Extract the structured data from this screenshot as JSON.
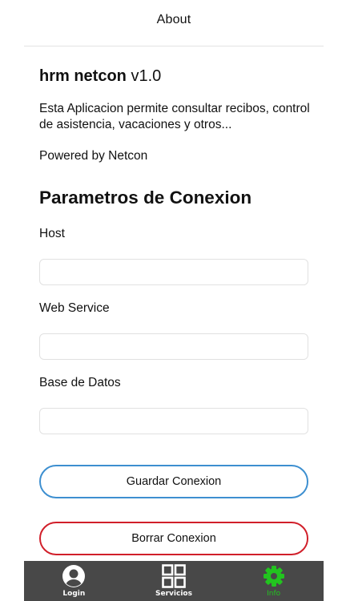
{
  "header": {
    "title": "About"
  },
  "about": {
    "app_name": "hrm netcon",
    "version": "v1.0",
    "description": "Esta Aplicacion permite consultar recibos, control de asistencia, vacaciones y otros...",
    "powered_by": "Powered by Netcon"
  },
  "connection": {
    "section_title": "Parametros de Conexion",
    "host_label": "Host",
    "host_value": "",
    "webservice_label": "Web Service",
    "webservice_value": "",
    "database_label": "Base de Datos",
    "database_value": ""
  },
  "buttons": {
    "save_label": "Guardar Conexion",
    "delete_label": "Borrar Conexion"
  },
  "tabs": [
    {
      "label": "Login",
      "icon": "user-avatar-icon",
      "active": false
    },
    {
      "label": "Servicios",
      "icon": "grid-icon",
      "active": false
    },
    {
      "label": "Info",
      "icon": "gear-icon",
      "active": true
    }
  ],
  "colors": {
    "save_border": "#3d8fd0",
    "delete_border": "#d11f2a",
    "tabbar_bg": "#484848",
    "active_tab": "#22c41f"
  }
}
